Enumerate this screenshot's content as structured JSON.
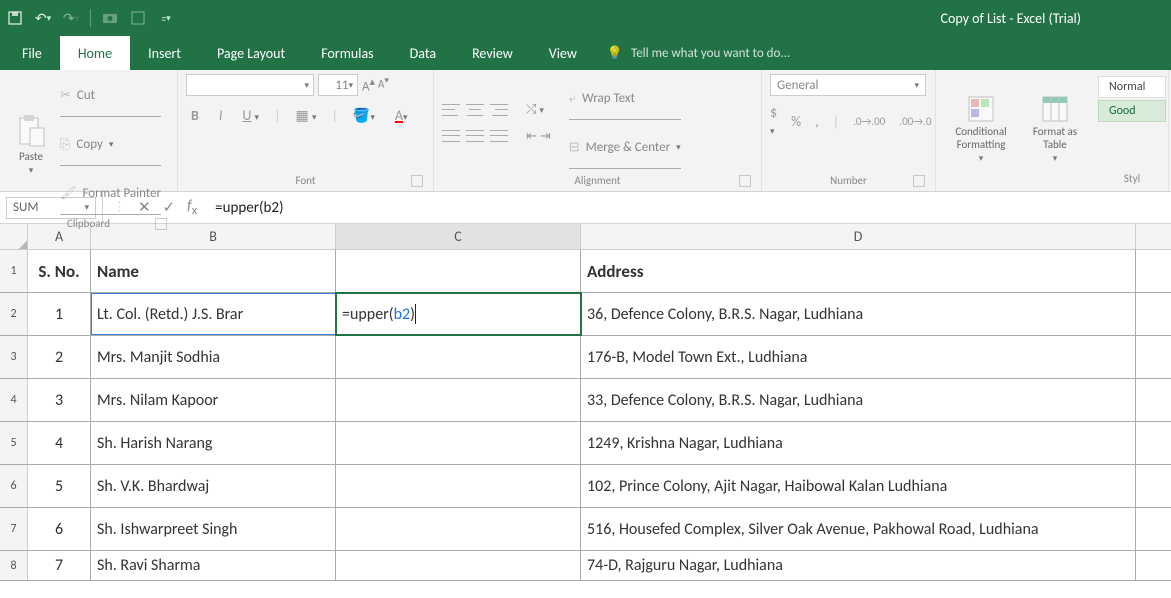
{
  "app": {
    "title": "Copy of List - Excel (Trial)"
  },
  "tabs": {
    "file": "File",
    "home": "Home",
    "insert": "Insert",
    "pagelayout": "Page Layout",
    "formulas": "Formulas",
    "data": "Data",
    "review": "Review",
    "view": "View",
    "tellme": "Tell me what you want to do..."
  },
  "ribbon": {
    "clipboard": {
      "title": "Clipboard",
      "paste": "Paste",
      "cut": "Cut",
      "copy": "Copy",
      "formatpainter": "Format Painter"
    },
    "font": {
      "title": "Font",
      "size": "11"
    },
    "alignment": {
      "title": "Alignment",
      "wrap": "Wrap Text",
      "merge": "Merge & Center"
    },
    "number": {
      "title": "Number",
      "format": "General"
    },
    "cond": "Conditional Formatting",
    "fmtas": "Format as Table",
    "styles": {
      "title": "Styl",
      "normal": "Normal",
      "good": "Good"
    }
  },
  "fx": {
    "name": "SUM",
    "formula": "=upper(b2)"
  },
  "columns": {
    "a": "A",
    "b": "B",
    "c": "C",
    "d": "D"
  },
  "headers": {
    "sno": "S. No.",
    "name": "Name",
    "blank": "",
    "address": "Address"
  },
  "rowNums": {
    "r1": "1",
    "r2": "2",
    "r3": "3",
    "r4": "4",
    "r5": "5",
    "r6": "6",
    "r7": "7",
    "r8": "8"
  },
  "data": [
    {
      "sno": "1",
      "name": "Lt. Col. (Retd.) J.S. Brar",
      "c": "=upper(b2)",
      "address": "36, Defence Colony, B.R.S. Nagar, Ludhiana"
    },
    {
      "sno": "2",
      "name": "Mrs. Manjit Sodhia",
      "c": "",
      "address": "176-B, Model Town Ext., Ludhiana"
    },
    {
      "sno": "3",
      "name": "Mrs. Nilam Kapoor",
      "c": "",
      "address": "33, Defence Colony, B.R.S. Nagar, Ludhiana"
    },
    {
      "sno": "4",
      "name": "Sh. Harish Narang",
      "c": "",
      "address": "1249, Krishna Nagar, Ludhiana"
    },
    {
      "sno": "5",
      "name": "Sh. V.K. Bhardwaj",
      "c": "",
      "address": "102, Prince Colony, Ajit Nagar, Haibowal Kalan Ludhiana"
    },
    {
      "sno": "6",
      "name": "Sh. Ishwarpreet Singh",
      "c": "",
      "address": "516, Housefed Complex, Silver Oak Avenue, Pakhowal Road, Ludhiana"
    },
    {
      "sno": "7",
      "name": "Sh. Ravi Sharma",
      "c": "",
      "address": "74-D, Rajguru Nagar, Ludhiana"
    }
  ],
  "chart_data": {
    "type": "table",
    "columns": [
      "S. No.",
      "Name",
      "",
      "Address"
    ],
    "rows": [
      [
        "1",
        "Lt. Col. (Retd.) J.S. Brar",
        "=upper(b2)",
        "36, Defence Colony, B.R.S. Nagar, Ludhiana"
      ],
      [
        "2",
        "Mrs. Manjit Sodhia",
        "",
        "176-B, Model Town Ext., Ludhiana"
      ],
      [
        "3",
        "Mrs. Nilam Kapoor",
        "",
        "33, Defence Colony, B.R.S. Nagar, Ludhiana"
      ],
      [
        "4",
        "Sh. Harish Narang",
        "",
        "1249, Krishna Nagar, Ludhiana"
      ],
      [
        "5",
        "Sh. V.K. Bhardwaj",
        "",
        "102, Prince Colony, Ajit Nagar, Haibowal Kalan Ludhiana"
      ],
      [
        "6",
        "Sh. Ishwarpreet Singh",
        "",
        "516, Housefed Complex, Silver Oak Avenue, Pakhowal Road, Ludhiana"
      ],
      [
        "7",
        "Sh. Ravi Sharma",
        "",
        "74-D, Rajguru Nagar, Ludhiana"
      ]
    ]
  }
}
